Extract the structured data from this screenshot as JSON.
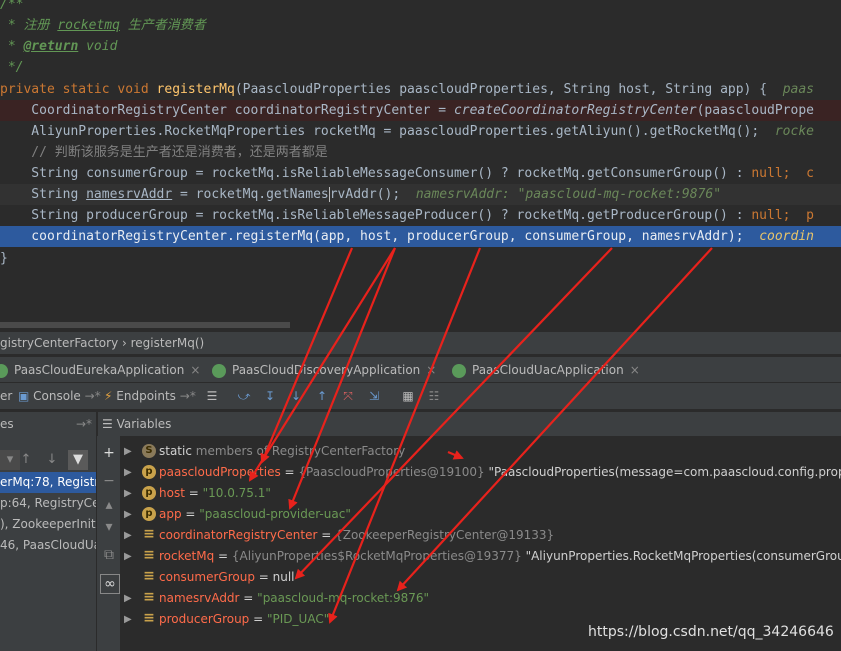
{
  "code": {
    "doc_open": "/**",
    "doc_line1_prefix": " * ",
    "doc_line1_cn1": "注册 ",
    "doc_line1_word": "rocketmq",
    "doc_line1_cn2": " 生产者消费者",
    "doc_return_prefix": " * ",
    "doc_return_tag": "@return",
    "doc_return_rest": " void",
    "doc_close": " */",
    "sig_mod": "private static void ",
    "sig_name": "registerMq",
    "sig_params": "(PaascloudProperties paascloudProperties, String host, String app) {  ",
    "sig_hint": "paas",
    "l1_code": "    CoordinatorRegistryCenter coordinatorRegistryCenter = ",
    "l1_call": "createCoordinatorRegistryCenter",
    "l1_rest": "(paascloudPrope",
    "l2_code": "    AliyunProperties.RocketMqProperties rocketMq = paascloudProperties.getAliyun().getRocketMq();  ",
    "l2_hint": "rocke",
    "l3_comment": "    // 判断该服务是生产者还是消费者，还是两者都是",
    "l4_code": "    String consumerGroup = rocketMq.isReliableMessageConsumer() ? rocketMq.getConsumerGroup() : ",
    "l4_null": "null",
    "l4_end": ";  c",
    "l5_code_a": "    String ",
    "l5_var": "namesrvAddr",
    "l5_code_b": " = rocketMq.getNames",
    "l5_code_c": "rvAddr();  ",
    "l5_hint": "namesrvAddr: \"paascloud-mq-rocket:9876\"",
    "l6_code": "    String producerGroup = rocketMq.isReliableMessageProducer() ? rocketMq.getProducerGroup() : ",
    "l6_null": "null",
    "l6_end": ";  p",
    "l7_code": "    coordinatorRegistryCenter.registerMq(app, host, producerGroup, consumerGroup, namesrvAddr);  ",
    "l7_hint": "coordin",
    "close_brace": "}"
  },
  "breadcrumb": {
    "class_name": "gistryCenterFactory",
    "sep": "  ›  ",
    "method": "registerMq()"
  },
  "tabs": [
    {
      "label": "PaasCloudEurekaApplication"
    },
    {
      "label": "PaasCloudDiscoveryApplication"
    },
    {
      "label": "PaasCloudUacApplication"
    }
  ],
  "toolbar": {
    "left": "er",
    "console": "Console",
    "endpoints": "Endpoints",
    "pin": "→*"
  },
  "panels": {
    "frames_header": "es",
    "frames_pin": "→*",
    "variables_header": "Variables"
  },
  "frames": [
    {
      "label": "erMq:78, Registr"
    },
    {
      "label": "p:64, RegistryCer"
    },
    {
      "label": "), ZookeeperInitR"
    },
    {
      "label": "46, PaasCloudUa"
    }
  ],
  "variables": [
    {
      "name": "static",
      "rest": " members of RegistryCenterFactory",
      "icon": "S"
    },
    {
      "name": "paascloudProperties",
      "eq": " = ",
      "ref": "{PaascloudProperties@19100}",
      "val": " \"PaascloudProperties(message=com.paascloud.config.properti"
    },
    {
      "name": "host",
      "eq": " = ",
      "str": "\"10.0.75.1\""
    },
    {
      "name": "app",
      "eq": " = ",
      "str": "\"paascloud-provider-uac\""
    },
    {
      "name": "coordinatorRegistryCenter",
      "eq": " = ",
      "ref": "{ZookeeperRegistryCenter@19133}"
    },
    {
      "name": "rocketMq",
      "eq": " = ",
      "ref": "{AliyunProperties$RocketMqProperties@19377}",
      "val": " \"AliyunProperties.RocketMqProperties(consumerGroup="
    },
    {
      "name": "consumerGroup",
      "eq": " = ",
      "val": "null"
    },
    {
      "name": "namesrvAddr",
      "eq": " = ",
      "str": "\"paascloud-mq-rocket:9876\""
    },
    {
      "name": "producerGroup",
      "eq": " = ",
      "str": "\"PID_UAC\""
    }
  ],
  "watermark": "https://blog.csdn.net/qq_34246646",
  "colors": {
    "arrow": "#e8221c",
    "selection": "#2d5a9e"
  }
}
